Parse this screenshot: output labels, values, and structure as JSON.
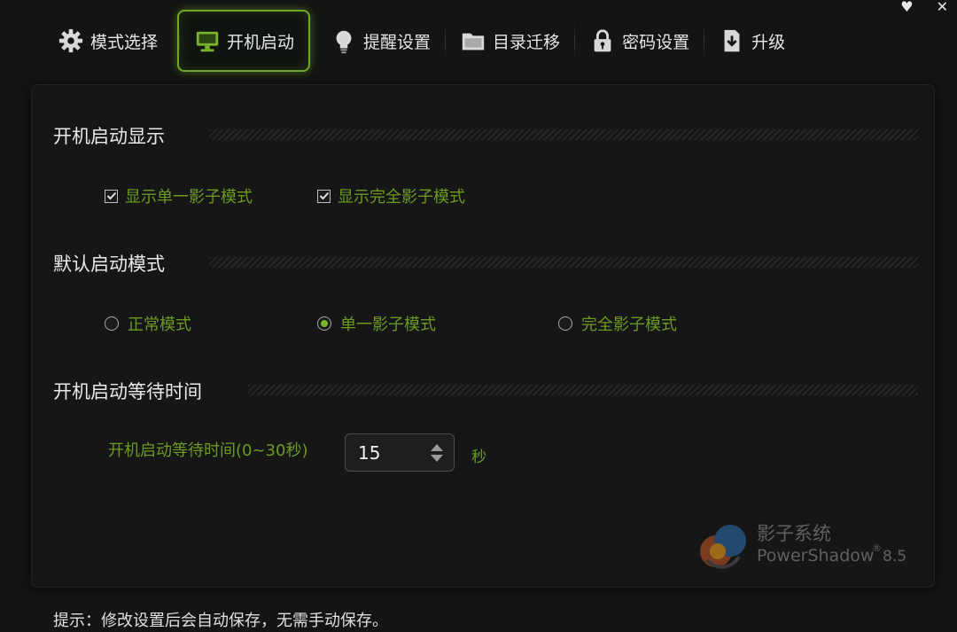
{
  "window": {
    "minimize_glyph": "♥",
    "close_glyph": "✕"
  },
  "tabs": [
    {
      "label": "模式选择",
      "icon": "gear-icon"
    },
    {
      "label": "开机启动",
      "icon": "monitor-icon",
      "active": true
    },
    {
      "label": "提醒设置",
      "icon": "bulb-icon"
    },
    {
      "label": "目录迁移",
      "icon": "folder-icon"
    },
    {
      "label": "密码设置",
      "icon": "lock-icon"
    },
    {
      "label": "升级",
      "icon": "upgrade-icon"
    }
  ],
  "sections": {
    "display": {
      "title": "开机启动显示",
      "options": [
        {
          "label": "显示单一影子模式",
          "checked": true
        },
        {
          "label": "显示完全影子模式",
          "checked": true
        }
      ]
    },
    "mode": {
      "title": "默认启动模式",
      "options": [
        {
          "label": "正常模式",
          "selected": false
        },
        {
          "label": "单一影子模式",
          "selected": true
        },
        {
          "label": "完全影子模式",
          "selected": false
        }
      ]
    },
    "wait": {
      "title": "开机启动等待时间",
      "label": "开机启动等待时间(0~30秒)",
      "value": "15",
      "unit": "秒"
    }
  },
  "brand": {
    "name_cn": "影子系统",
    "name_en": "PowerShadow",
    "registered": "®",
    "version": "8.5"
  },
  "footer": {
    "tip": "提示：修改设置后会自动保存，无需手动保存。"
  },
  "colors": {
    "accent": "#6ea82a",
    "option_text": "#6c9a22",
    "background": "#141414"
  }
}
